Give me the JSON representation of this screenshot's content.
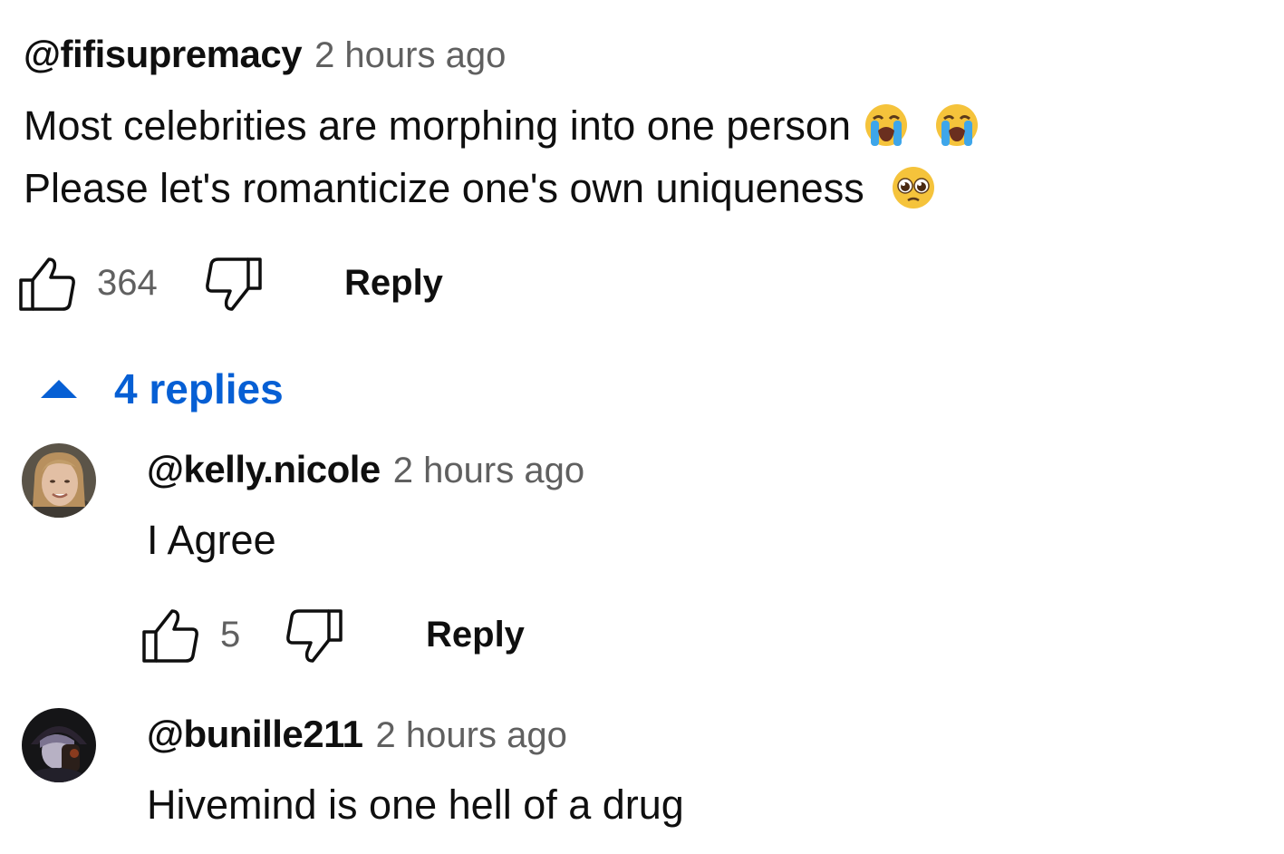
{
  "comment": {
    "author": "@fifisupremacy",
    "time": "2 hours ago",
    "line1": "Most celebrities are morphing into one person",
    "line2": "Please let's romanticize one's own uniqueness",
    "line1_emojis": [
      "loudly-crying-face",
      "loudly-crying-face"
    ],
    "line2_emojis": [
      "pleading-face"
    ],
    "likes": "364",
    "reply_label": "Reply"
  },
  "replies_toggle": {
    "label": "4 replies",
    "icon": "caret-up-icon",
    "color": "#065fd4"
  },
  "replies": [
    {
      "author": "@kelly.nicole",
      "time": "2 hours ago",
      "text": "I Agree",
      "likes": "5",
      "reply_label": "Reply",
      "avatar": "avatar-photo-woman"
    },
    {
      "author": "@bunille211",
      "time": "2 hours ago",
      "text": "Hivemind is one hell of a drug",
      "avatar": "avatar-dark-illustration"
    }
  ],
  "colors": {
    "text": "#0f0f0f",
    "secondary": "#606060",
    "link": "#065fd4"
  }
}
